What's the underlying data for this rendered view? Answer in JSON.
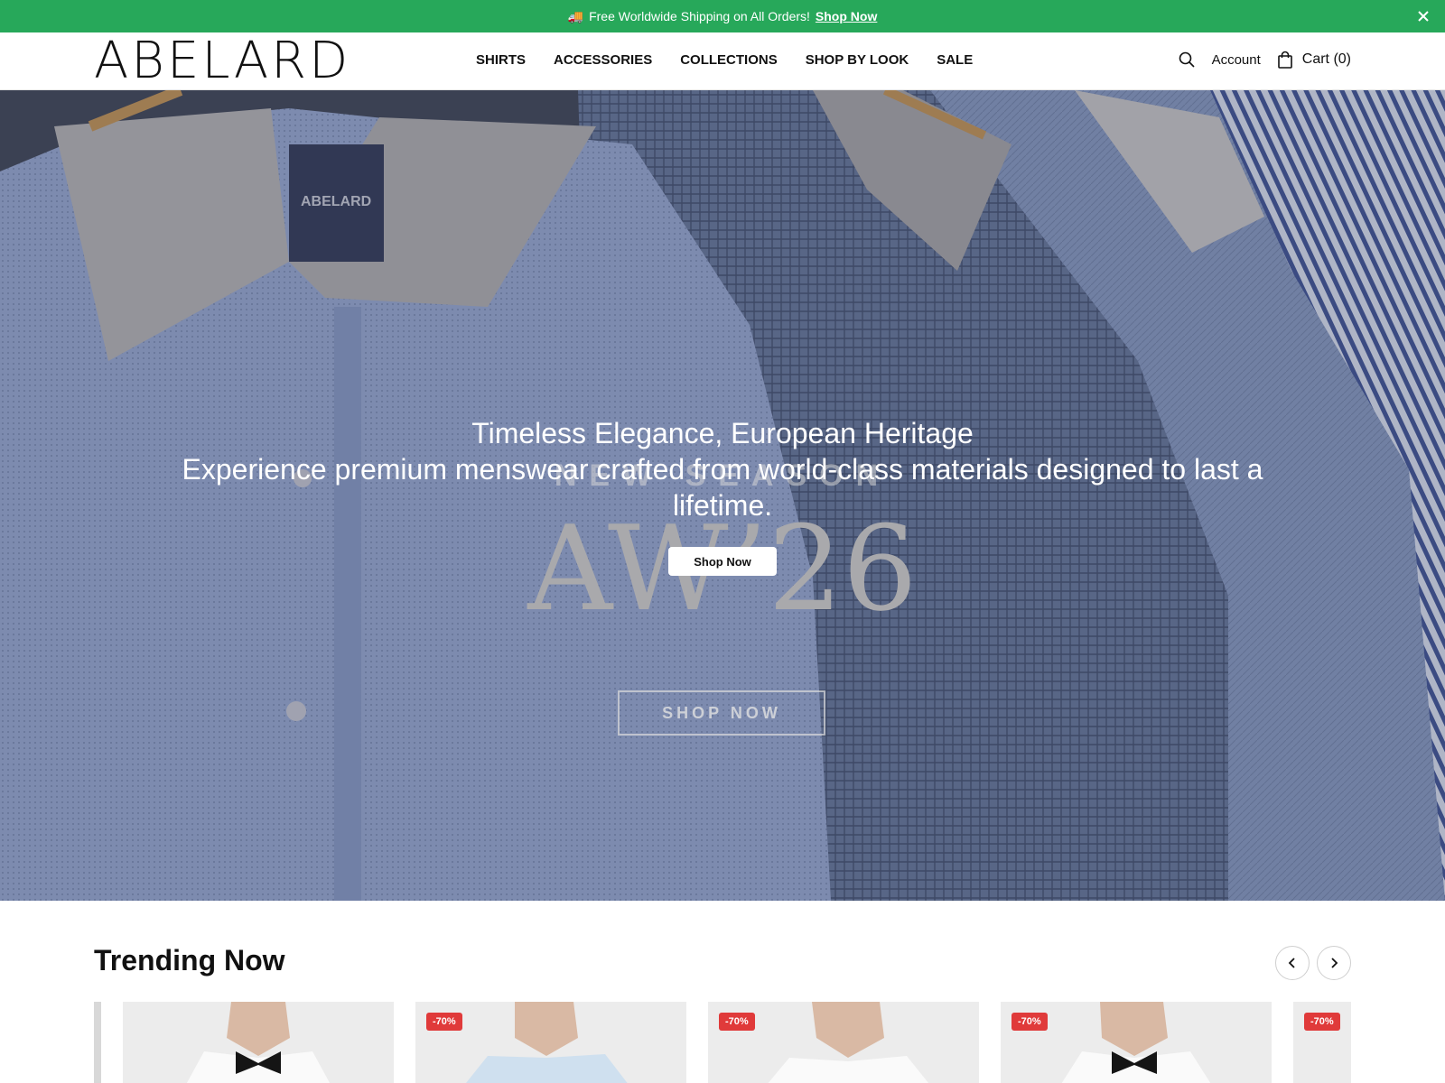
{
  "announcement": {
    "icon": "truck-icon",
    "text": "Free Worldwide Shipping on All Orders!",
    "link": "Shop Now"
  },
  "header": {
    "logo": "ABELARD",
    "nav": [
      "SHIRTS",
      "ACCESSORIES",
      "COLLECTIONS",
      "SHOP BY LOOK",
      "SALE"
    ],
    "account": "Account",
    "cart": "Cart (0)"
  },
  "hero": {
    "title": "Timeless Elegance, European Heritage",
    "subtitle": "Experience premium menswear crafted from world-class materials designed to last a lifetime.",
    "button": "Shop Now",
    "season_label": "NEW SEASON",
    "season_big": "AW’26",
    "image_button": "SHOP NOW",
    "label_text": "ABELARD"
  },
  "trending": {
    "title": "Trending Now",
    "cards": [
      {
        "badge": ""
      },
      {
        "badge": "-70%"
      },
      {
        "badge": "-70%"
      },
      {
        "badge": "-70%"
      },
      {
        "badge": "-70%"
      }
    ]
  },
  "colors": {
    "announce_bg": "#27a85a",
    "badge_bg": "#e03a3a"
  }
}
